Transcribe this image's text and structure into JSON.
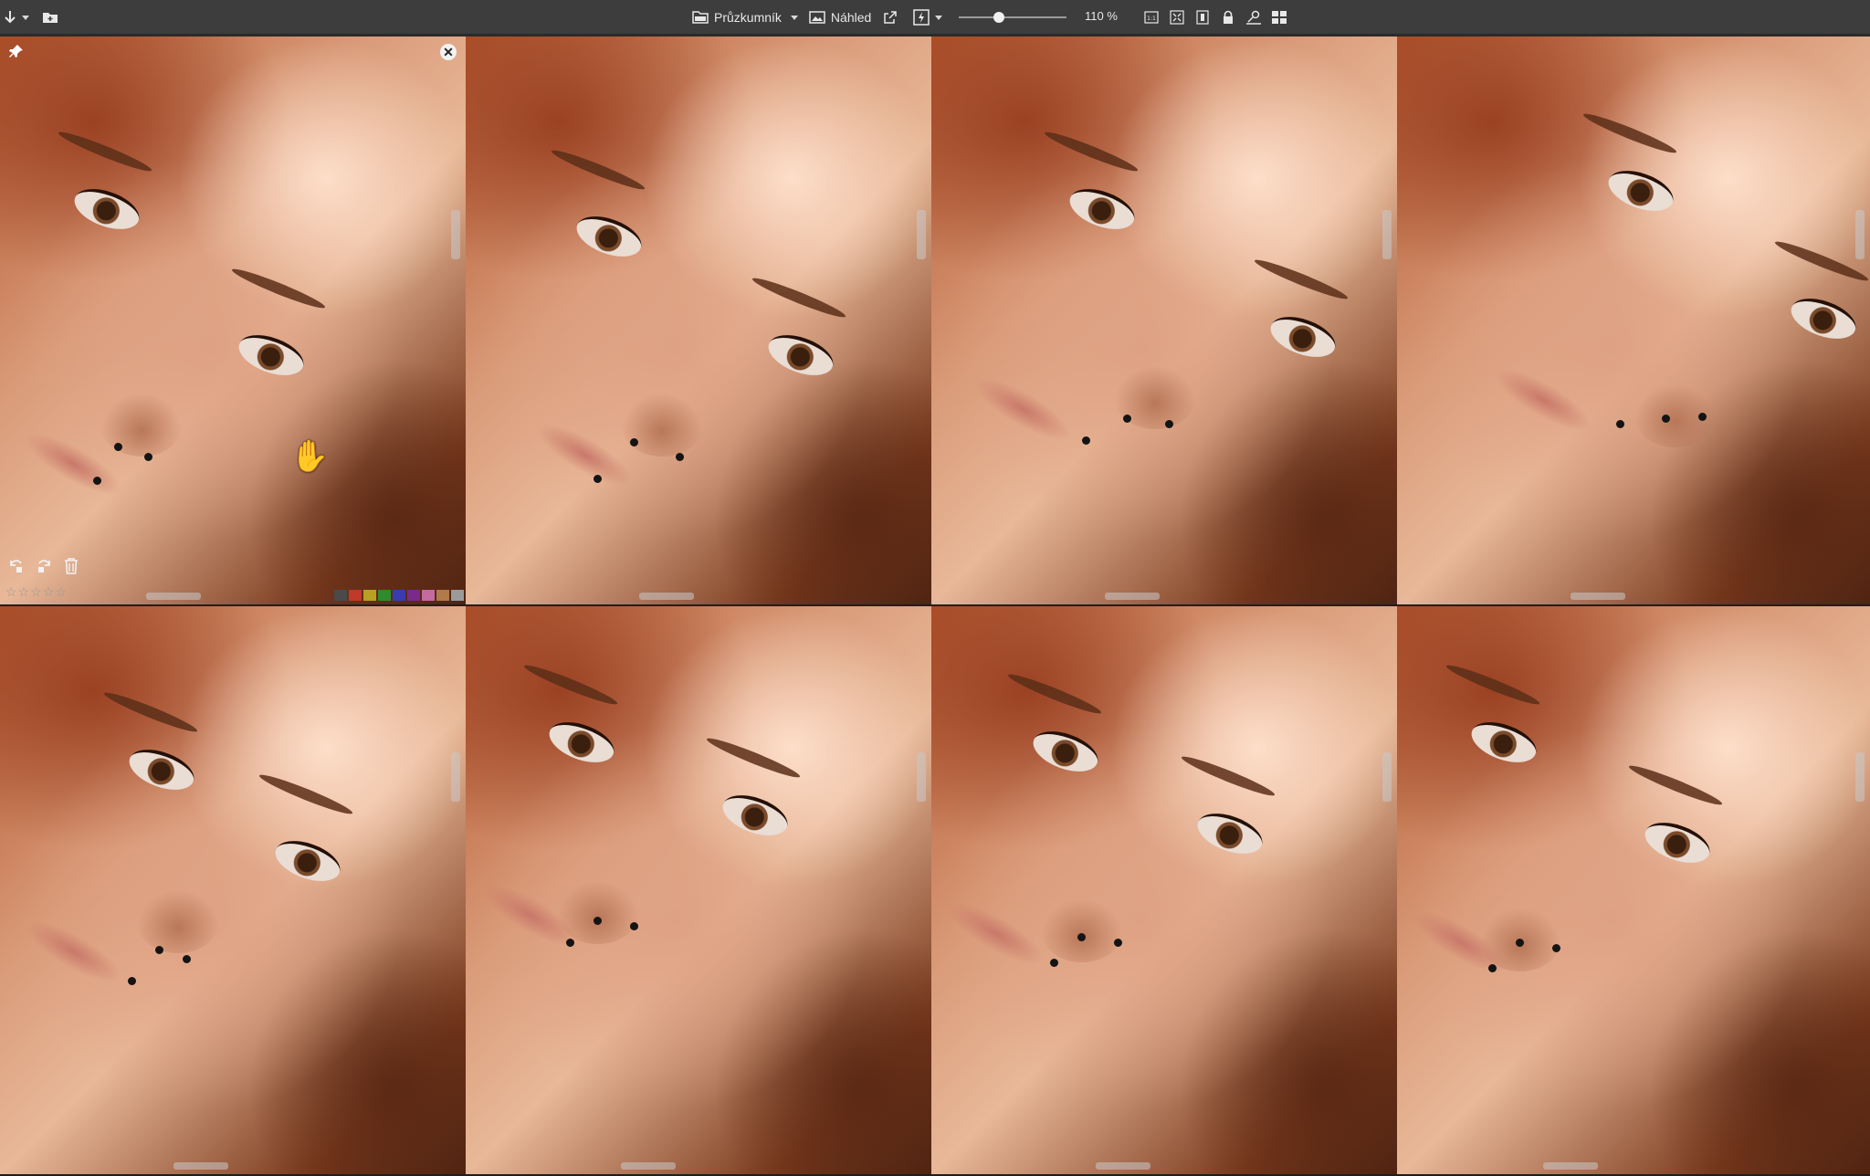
{
  "toolbar": {
    "browse_label": "Průzkumník",
    "preview_label": "Náhled",
    "zoom_text": "110 %",
    "zoom_level_fraction": 0.37,
    "icons": [
      "import-arrow-icon",
      "new-folder-icon",
      "browse-icon",
      "preview-icon",
      "external-editor-icon",
      "quick-fix-icon",
      "fit-1to1-icon",
      "fit-screen-icon",
      "fit-width-icon",
      "lock-icon",
      "sync-zoom-icon",
      "grid-layout-icon"
    ]
  },
  "tile_controls": {
    "close_glyph": "✕",
    "rating_stars": 5,
    "rating_value": 0,
    "color_labels": [
      "#4a4a4a",
      "#c0392b",
      "#b8a021",
      "#2e8b2e",
      "#3b3bb0",
      "#7a2a8a",
      "#c46aa0",
      "#b07a4a",
      "#9a9a9a"
    ]
  },
  "tiles": [
    {
      "index": 1,
      "active": true
    },
    {
      "index": 2,
      "active": false
    },
    {
      "index": 3,
      "active": false
    },
    {
      "index": 4,
      "active": false
    },
    {
      "index": 5,
      "active": false
    },
    {
      "index": 6,
      "active": false
    },
    {
      "index": 7,
      "active": false
    },
    {
      "index": 8,
      "active": false
    }
  ]
}
